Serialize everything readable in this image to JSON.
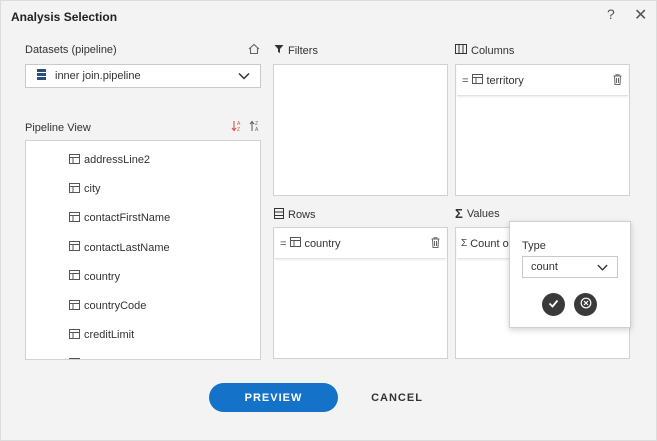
{
  "dialog": {
    "title": "Analysis Selection",
    "help": "?",
    "close": "✕"
  },
  "datasets": {
    "label": "Datasets (pipeline)",
    "selected": "inner join.pipeline"
  },
  "pipeline_view": {
    "label": "Pipeline View",
    "items": [
      "addressLine2",
      "city",
      "contactFirstName",
      "contactLastName",
      "country",
      "countryCode",
      "creditLimit"
    ]
  },
  "filters": {
    "label": "Filters"
  },
  "columns": {
    "label": "Columns",
    "items": [
      "territory"
    ]
  },
  "rows": {
    "label": "Rows",
    "items": [
      "country"
    ]
  },
  "values": {
    "label": "Values",
    "items": [
      "Count o"
    ]
  },
  "popup": {
    "type_label": "Type",
    "type_value": "count"
  },
  "buttons": {
    "preview": "PREVIEW",
    "cancel": "CANCEL"
  },
  "colors": {
    "primary": "#1473c9",
    "sort_accent": "#d9534f",
    "dark_button": "#3a3a3a"
  }
}
